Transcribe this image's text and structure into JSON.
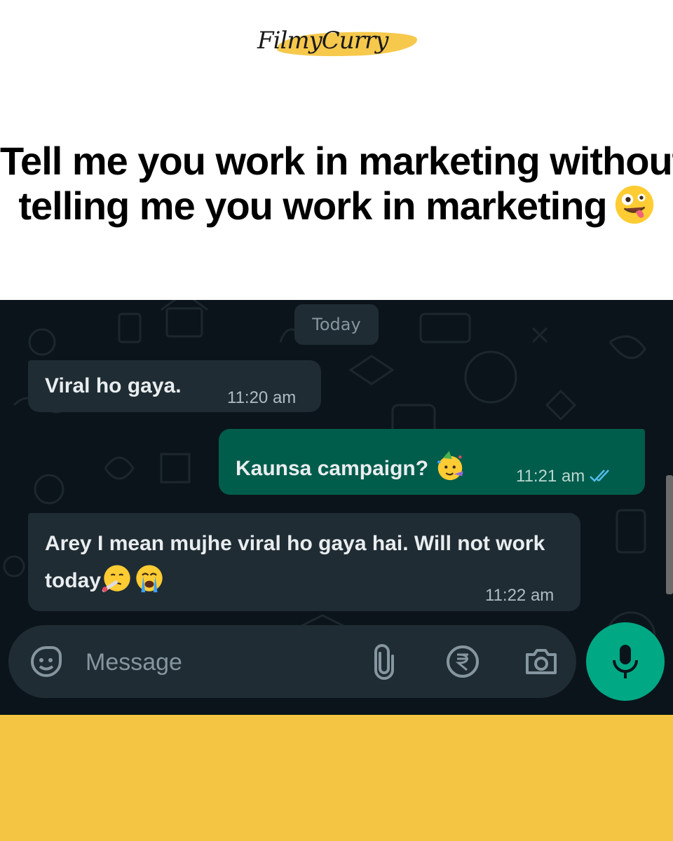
{
  "brand": {
    "logo_text": "FilmyCurry",
    "accent_color": "#f5c542"
  },
  "headline": {
    "line1": "Tell me you work in marketing without",
    "line2": "telling me you work in marketing",
    "emoji": "zany-face"
  },
  "chat": {
    "date_label": "Today",
    "background_color": "#0b141a",
    "messages": [
      {
        "direction": "incoming",
        "text": "Viral ho gaya.",
        "time": "11:20 am"
      },
      {
        "direction": "outgoing",
        "text": "Kaunsa campaign?",
        "emoji": "partying-face",
        "time": "11:21 am",
        "status": "read"
      },
      {
        "direction": "incoming",
        "text": "Arey I mean mujhe viral ho gaya hai. Will not work today",
        "emojis": [
          "face-with-thermometer",
          "loudly-crying-face"
        ],
        "time": "11:22 am"
      }
    ],
    "input": {
      "placeholder": "Message",
      "icons": [
        "sticker-icon",
        "attach-icon",
        "rupee-icon",
        "camera-icon"
      ]
    },
    "mic_color": "#00a884"
  },
  "footer": {
    "band_color": "#f4c542"
  }
}
